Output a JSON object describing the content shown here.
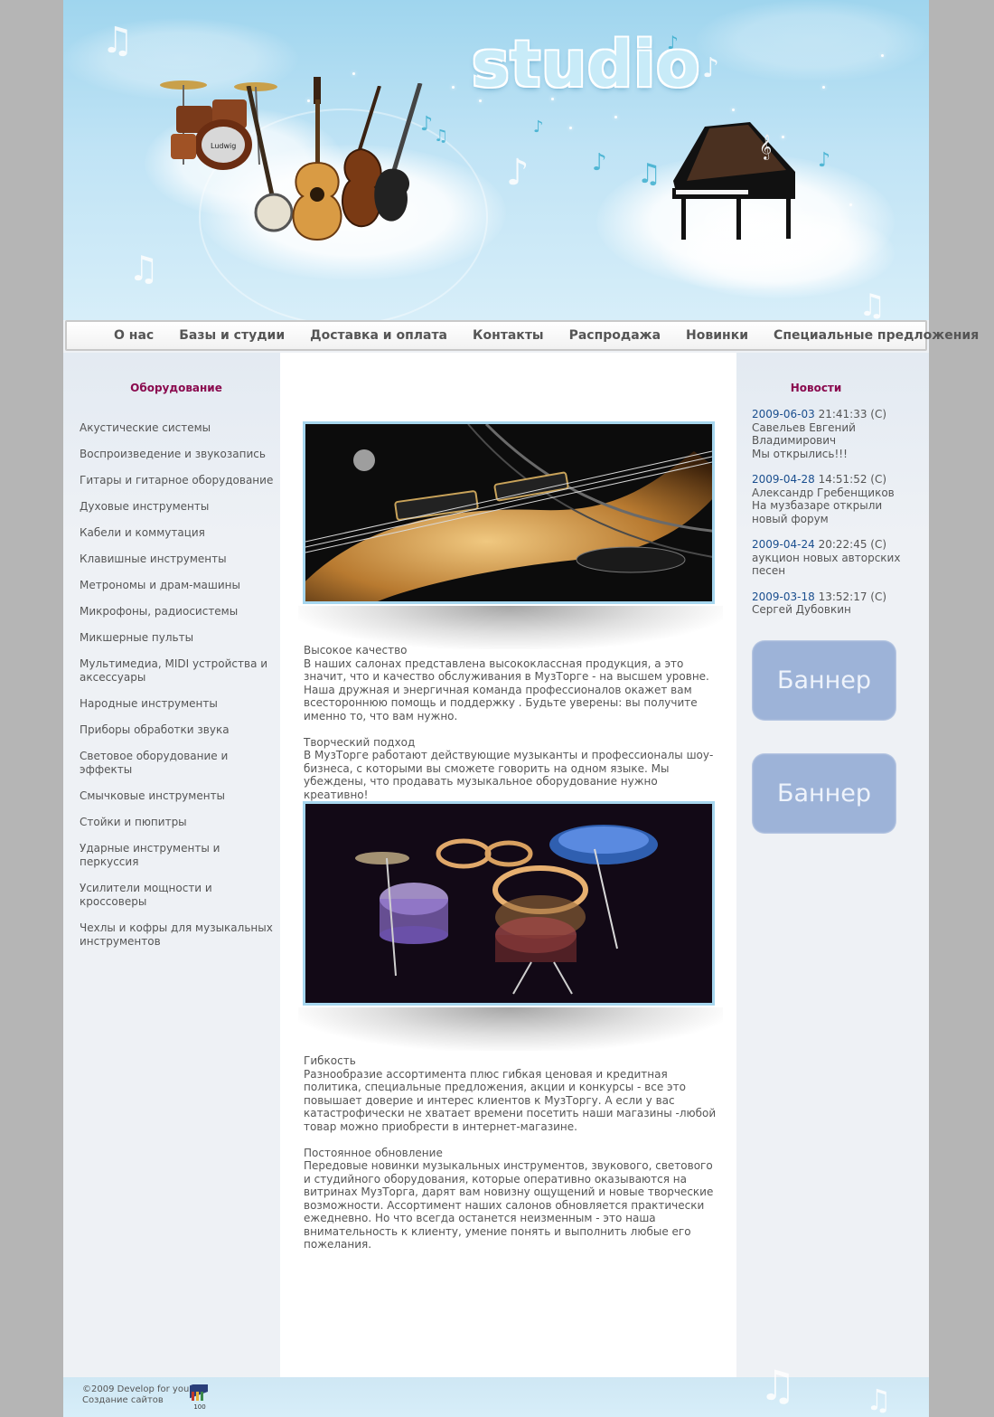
{
  "header": {
    "logo_text": "studio"
  },
  "nav": {
    "items": [
      {
        "label": "О нас"
      },
      {
        "label": "Базы и студии"
      },
      {
        "label": "Доставка и оплата"
      },
      {
        "label": "Контакты"
      },
      {
        "label": "Распродажа"
      },
      {
        "label": "Новинки"
      },
      {
        "label": "Специальные предложения"
      }
    ]
  },
  "sidebar": {
    "title": "Оборудование",
    "items": [
      {
        "label": "Акустические системы"
      },
      {
        "label": "Воспроизведение и звукозапись"
      },
      {
        "label": "Гитары и гитарное оборудование"
      },
      {
        "label": "Духовые инструменты"
      },
      {
        "label": "Кабели и коммутация"
      },
      {
        "label": "Клавишные инструменты"
      },
      {
        "label": "Метрономы и драм-машины"
      },
      {
        "label": "Микрофоны, радиосистемы"
      },
      {
        "label": "Микшерные пульты"
      },
      {
        "label": "Мультимедиа, MIDI устройства и аксессуары"
      },
      {
        "label": "Народные инструменты"
      },
      {
        "label": "Приборы обработки звука"
      },
      {
        "label": "Световое оборудование и эффекты"
      },
      {
        "label": "Смычковые инструменты"
      },
      {
        "label": "Стойки и пюпитры"
      },
      {
        "label": "Ударные инструменты и перкуссия"
      },
      {
        "label": "Усилители мощности и кроссоверы"
      },
      {
        "label": "Чехлы и кофры для музыкальных инструментов"
      }
    ]
  },
  "main": {
    "sections": [
      {
        "heading": "Высокое качество",
        "text": "В наших салонах представлена высококлассная продукция, а это значит, что и качество обслуживания в МузТорге - на высшем уровне. Наша дружная и энергичная команда профессионалов окажет вам всестороннюю помощь и поддержку . Будьте уверены: вы получите именно то, что вам нужно."
      },
      {
        "heading": "Творческий подход",
        "text": "В МузТорге работают действующие музыканты и профессионалы шоу-бизнеса, с которыми вы сможете говорить на одном языке. Мы убеждены, что продавать музыкальное оборудование нужно креативно!"
      },
      {
        "heading": "Гибкость",
        "text": "Разнообразие ассортимента плюс гибкая ценовая и кредитная политика, специальные предложения, акции и конкурсы - все это повышает доверие и интерес клиентов к МузТоргу. А если у вас катастрофически не хватает времени посетить наши магазины -любой товар можно приобрести в интернет-магазине."
      },
      {
        "heading": "Постоянное обновление",
        "text": "Передовые новинки музыкальных инструментов, звукового, светового и студийного оборудования, которые оперативно оказываются на витринах МузТорга, дарят вам новизну ощущений и новые творческие возможности. Ассортимент наших салонов обновляется практически ежедневно. Но что всегда останется неизменным - это наша внимательность к клиенту, умение понять и выполнить любые его пожелания."
      }
    ]
  },
  "news": {
    "title": "Новости",
    "items": [
      {
        "date": "2009-06-03",
        "time": "21:41:33 (C)",
        "author": "Савельев Евгений Владимирович",
        "text": "Мы открылись!!!"
      },
      {
        "date": "2009-04-28",
        "time": "14:51:52 (C)",
        "author": "Александр Гребенщиков",
        "text": "На музбазаре открыли новый форум"
      },
      {
        "date": "2009-04-24",
        "time": "20:22:45 (C)",
        "author": "",
        "text": "аукцион новых авторских песен"
      },
      {
        "date": "2009-03-18",
        "time": "13:52:17 (C)",
        "author": "Сергей Дубовкин",
        "text": ""
      }
    ]
  },
  "banners": [
    {
      "label": "Баннер"
    },
    {
      "label": "Баннер"
    }
  ],
  "footer": {
    "line1": "©2009 Develop for you",
    "line2": "Создание сайтов",
    "badge_text": "100"
  },
  "colors": {
    "sky": "#9fd5ee",
    "nav_text": "#555555",
    "section_title": "#8a0a4e",
    "news_date": "#1a4e8e",
    "banner": "#9db3d8",
    "photo_border": "#a6d6ee"
  },
  "icons": [
    "music-note-icon",
    "drum-kit-icon",
    "guitar-icon",
    "violin-icon",
    "piano-icon",
    "footer-badge-icon"
  ]
}
